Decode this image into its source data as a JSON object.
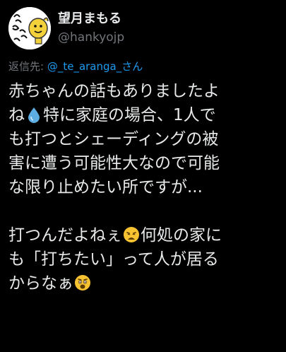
{
  "author": {
    "display_name": "望月まもる",
    "handle": "@hankyojp",
    "avatar_icon": "avatar-illustration"
  },
  "reply": {
    "prefix": "返信先: ",
    "mention": "@_te_aranga_さん"
  },
  "body": {
    "line1": "赤ちゃんの話もありましたよ",
    "line2_before": "ね",
    "line2_after": "特に家庭の場合、1人で",
    "line3": "も打つとシェーディングの被",
    "line4": "害に遭う可能性大なので可能",
    "line5": "な限り止めたい所ですが...",
    "line6_before": "打つんだよねぇ",
    "line6_after": "何処の家に",
    "line7": "も「打ちたい」って人が居る",
    "line8_before": "からなぁ"
  },
  "emojis": {
    "droplet": "droplet-emoji",
    "weary": "weary-face-emoji",
    "anguished": "anguished-face-emoji"
  },
  "colors": {
    "background": "#000000",
    "text": "#e7e9ea",
    "secondary": "#71767b",
    "link": "#1d9bf0"
  }
}
